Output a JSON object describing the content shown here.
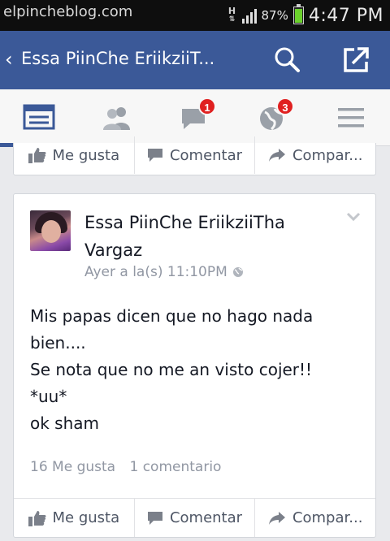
{
  "status_bar": {
    "watermark": "elpincheblog.com",
    "network": "H",
    "battery_percent": "87%",
    "battery_level": 0.87,
    "time": "4:47 PM"
  },
  "action_bar": {
    "title": "Essa PiinChe EriikziiT...",
    "back_icon": "chevron-left-icon",
    "search_icon": "search-icon",
    "share_icon": "share-external-icon"
  },
  "tabs": [
    {
      "icon": "news-feed-icon",
      "active": true
    },
    {
      "icon": "friends-icon",
      "badge": ""
    },
    {
      "icon": "messages-icon",
      "badge": "1"
    },
    {
      "icon": "globe-notifications-icon",
      "badge": "3"
    },
    {
      "icon": "menu-icon",
      "badge": ""
    }
  ],
  "actions": {
    "like": "Me gusta",
    "comment": "Comentar",
    "share": "Compar..."
  },
  "post": {
    "author_line1": "Essa PiinChe EriikziiTha",
    "author_line2": "Vargaz",
    "timestamp": "Ayer a la(s) 11:10PM",
    "lines": [
      "Mis papas dicen que no hago nada",
      "bien....",
      "Se nota que no me an visto cojer!!",
      "*uu*",
      "ok sham"
    ],
    "likes": "16 Me gusta",
    "comments": "1 comentario"
  },
  "colors": {
    "brand": "#3b5998",
    "badge": "#e02020",
    "background": "#e9eaed"
  }
}
